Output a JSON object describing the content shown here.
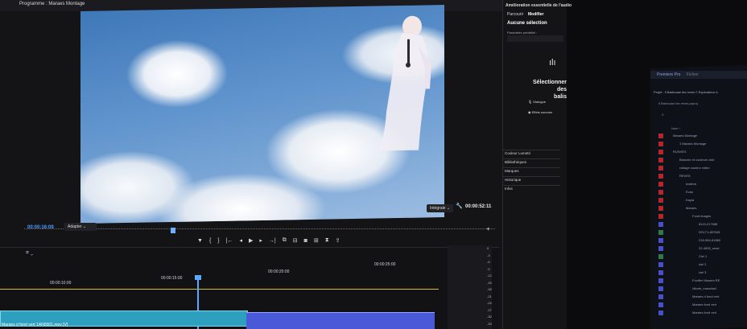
{
  "program_monitor": {
    "title": "Programme : Maraes Montage",
    "timecode_current": "00:00:16:09",
    "fit": "Adapter",
    "quality": "Intégrale",
    "timecode_duration": "00:00:52:11",
    "transport_icons": [
      "marker-icon",
      "in-point-icon",
      "out-point-icon",
      "go-to-in-icon",
      "step-back-icon",
      "play-icon",
      "step-forward-icon",
      "go-to-out-icon",
      "insert-icon",
      "overwrite-icon",
      "export-frame-icon",
      "compare-icon",
      "settings-icon",
      "vr-icon"
    ]
  },
  "timeline": {
    "tick_labels": [
      "00:00:10:00",
      "00:00:15:00",
      "00:00:20:00",
      "00:00:25:00"
    ],
    "clip_label": "Maraes d fond vert 1AN0001.mov [V]",
    "meter_scale": [
      "0",
      "-3",
      "-6",
      "-9",
      "-12",
      "-15",
      "-18",
      "-21",
      "-24",
      "-27",
      "-30",
      "-33"
    ]
  },
  "essential_audio": {
    "title": "Amélioration essentielle de l'audio",
    "tab_browse": "Parcourir",
    "tab_edit": "Modifier",
    "no_selection": "Aucune sélection",
    "preset_label": "Paramètre prédéfini :",
    "select_heading_1": "Sélectionner des",
    "select_heading_2": "balis",
    "dialogue": "Dialogue",
    "effects": "Effets sonores",
    "panels": [
      "Couleur Lumetri",
      "Bibliothèques",
      "Marques",
      "Historique",
      "Infos"
    ]
  },
  "second_monitor": {
    "app": "Premiere Pro",
    "menu": [
      "Fichier",
      "Édition"
    ],
    "tabs": "Projet : Il Barbouse les reves  ≡  Explorateur d",
    "breadcrumb": "Il Barbouse les reves.prproj",
    "column": "Nom ↑",
    "rows": [
      {
        "label": "Maraes Montage",
        "chip": "#b3262d",
        "indent": 0
      },
      {
        "label": "1 Maraes Montage",
        "chip": "#b3262d",
        "indent": 1
      },
      {
        "label": "RUSHES",
        "chip": "#b3262d",
        "indent": 0
      },
      {
        "label": "Blanche et couleurs vide",
        "chip": "#b3262d",
        "indent": 1
      },
      {
        "label": "collage couleur vidéo",
        "chip": "#b3262d",
        "indent": 1
      },
      {
        "label": "REVES",
        "chip": "#b3262d",
        "indent": 1
      },
      {
        "label": "Andrea",
        "chip": "#b3262d",
        "indent": 2
      },
      {
        "label": "Evan",
        "chip": "#b3262d",
        "indent": 2
      },
      {
        "label": "Kayla",
        "chip": "#b3262d",
        "indent": 2
      },
      {
        "label": "Maraes",
        "chip": "#b3262d",
        "indent": 2
      },
      {
        "label": "Fond images",
        "chip": "#b3262d",
        "indent": 3
      },
      {
        "label": "8113-217688",
        "chip": "#4a4fc7",
        "indent": 4
      },
      {
        "label": "DS171-857681",
        "chip": "#2f7a4a",
        "indent": 4
      },
      {
        "label": "218-984-81860",
        "chip": "#4a4fc7",
        "indent": 4
      },
      {
        "label": "22-4905_smal",
        "chip": "#4a4fc7",
        "indent": 4
      },
      {
        "label": "Ciel 1",
        "chip": "#2f7a4a",
        "indent": 4
      },
      {
        "label": "ciel 2",
        "chip": "#4a4fc7",
        "indent": 4
      },
      {
        "label": "ciel 3",
        "chip": "#4a4fc7",
        "indent": 4
      },
      {
        "label": "Fouiller Maraes RE",
        "chip": "#4a4fc7",
        "indent": 3
      },
      {
        "label": "i4barb_manufact",
        "chip": "#4a4fc7",
        "indent": 3
      },
      {
        "label": "Maraes d fond vert",
        "chip": "#4a4fc7",
        "indent": 3
      },
      {
        "label": "Maraes fond vert",
        "chip": "#4a4fc7",
        "indent": 3
      },
      {
        "label": "Maraes fond vert",
        "chip": "#4a4fc7",
        "indent": 3
      }
    ]
  }
}
